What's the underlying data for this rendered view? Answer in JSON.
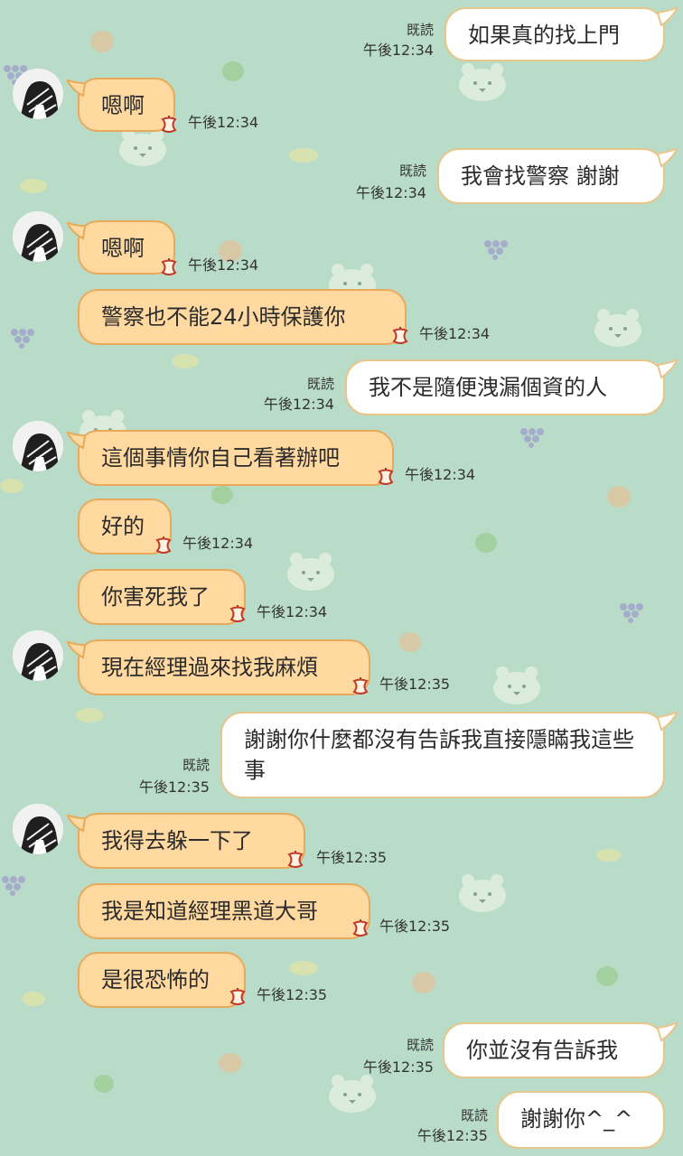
{
  "theme": {
    "background": "#b9dcc8",
    "incoming_bubble": "#ffd9a0",
    "incoming_border": "#e8a95a",
    "outgoing_bubble": "#ffffff",
    "outgoing_border": "#e8c58a"
  },
  "read_label": "既読",
  "messages": [
    {
      "dir": "out",
      "text": "如果真的找上門",
      "time": "午後12:34",
      "read": true
    },
    {
      "dir": "in",
      "text": "嗯啊",
      "time": "午後12:34",
      "avatar": true
    },
    {
      "dir": "out",
      "text": "我會找警察 謝謝",
      "time": "午後12:34",
      "read": true
    },
    {
      "dir": "in",
      "text": "嗯啊",
      "time": "午後12:34",
      "avatar": true
    },
    {
      "dir": "in",
      "text": "警察也不能24小時保護你",
      "time": "午後12:34"
    },
    {
      "dir": "out",
      "text": "我不是隨便洩漏個資的人",
      "time": "午後12:34",
      "read": true
    },
    {
      "dir": "in",
      "text": "這個事情你自己看著辦吧",
      "time": "午後12:34",
      "avatar": true
    },
    {
      "dir": "in",
      "text": "好的",
      "time": "午後12:34"
    },
    {
      "dir": "in",
      "text": "你害死我了",
      "time": "午後12:34"
    },
    {
      "dir": "in",
      "text": "現在經理過來找我麻煩",
      "time": "午後12:35",
      "avatar": true
    },
    {
      "dir": "out",
      "text": "謝謝你什麼都沒有告訴我直接隱瞞我這些事",
      "time": "午後12:35",
      "read": true
    },
    {
      "dir": "in",
      "text": "我得去躲一下了",
      "time": "午後12:35",
      "avatar": true
    },
    {
      "dir": "in",
      "text": "我是知道經理黑道大哥",
      "time": "午後12:35"
    },
    {
      "dir": "in",
      "text": "是很恐怖的",
      "time": "午後12:35"
    },
    {
      "dir": "out",
      "text": "你並沒有告訴我",
      "time": "午後12:35",
      "read": true
    },
    {
      "dir": "out",
      "text": "謝謝你^_^",
      "time": "午後12:35",
      "read": true
    }
  ]
}
